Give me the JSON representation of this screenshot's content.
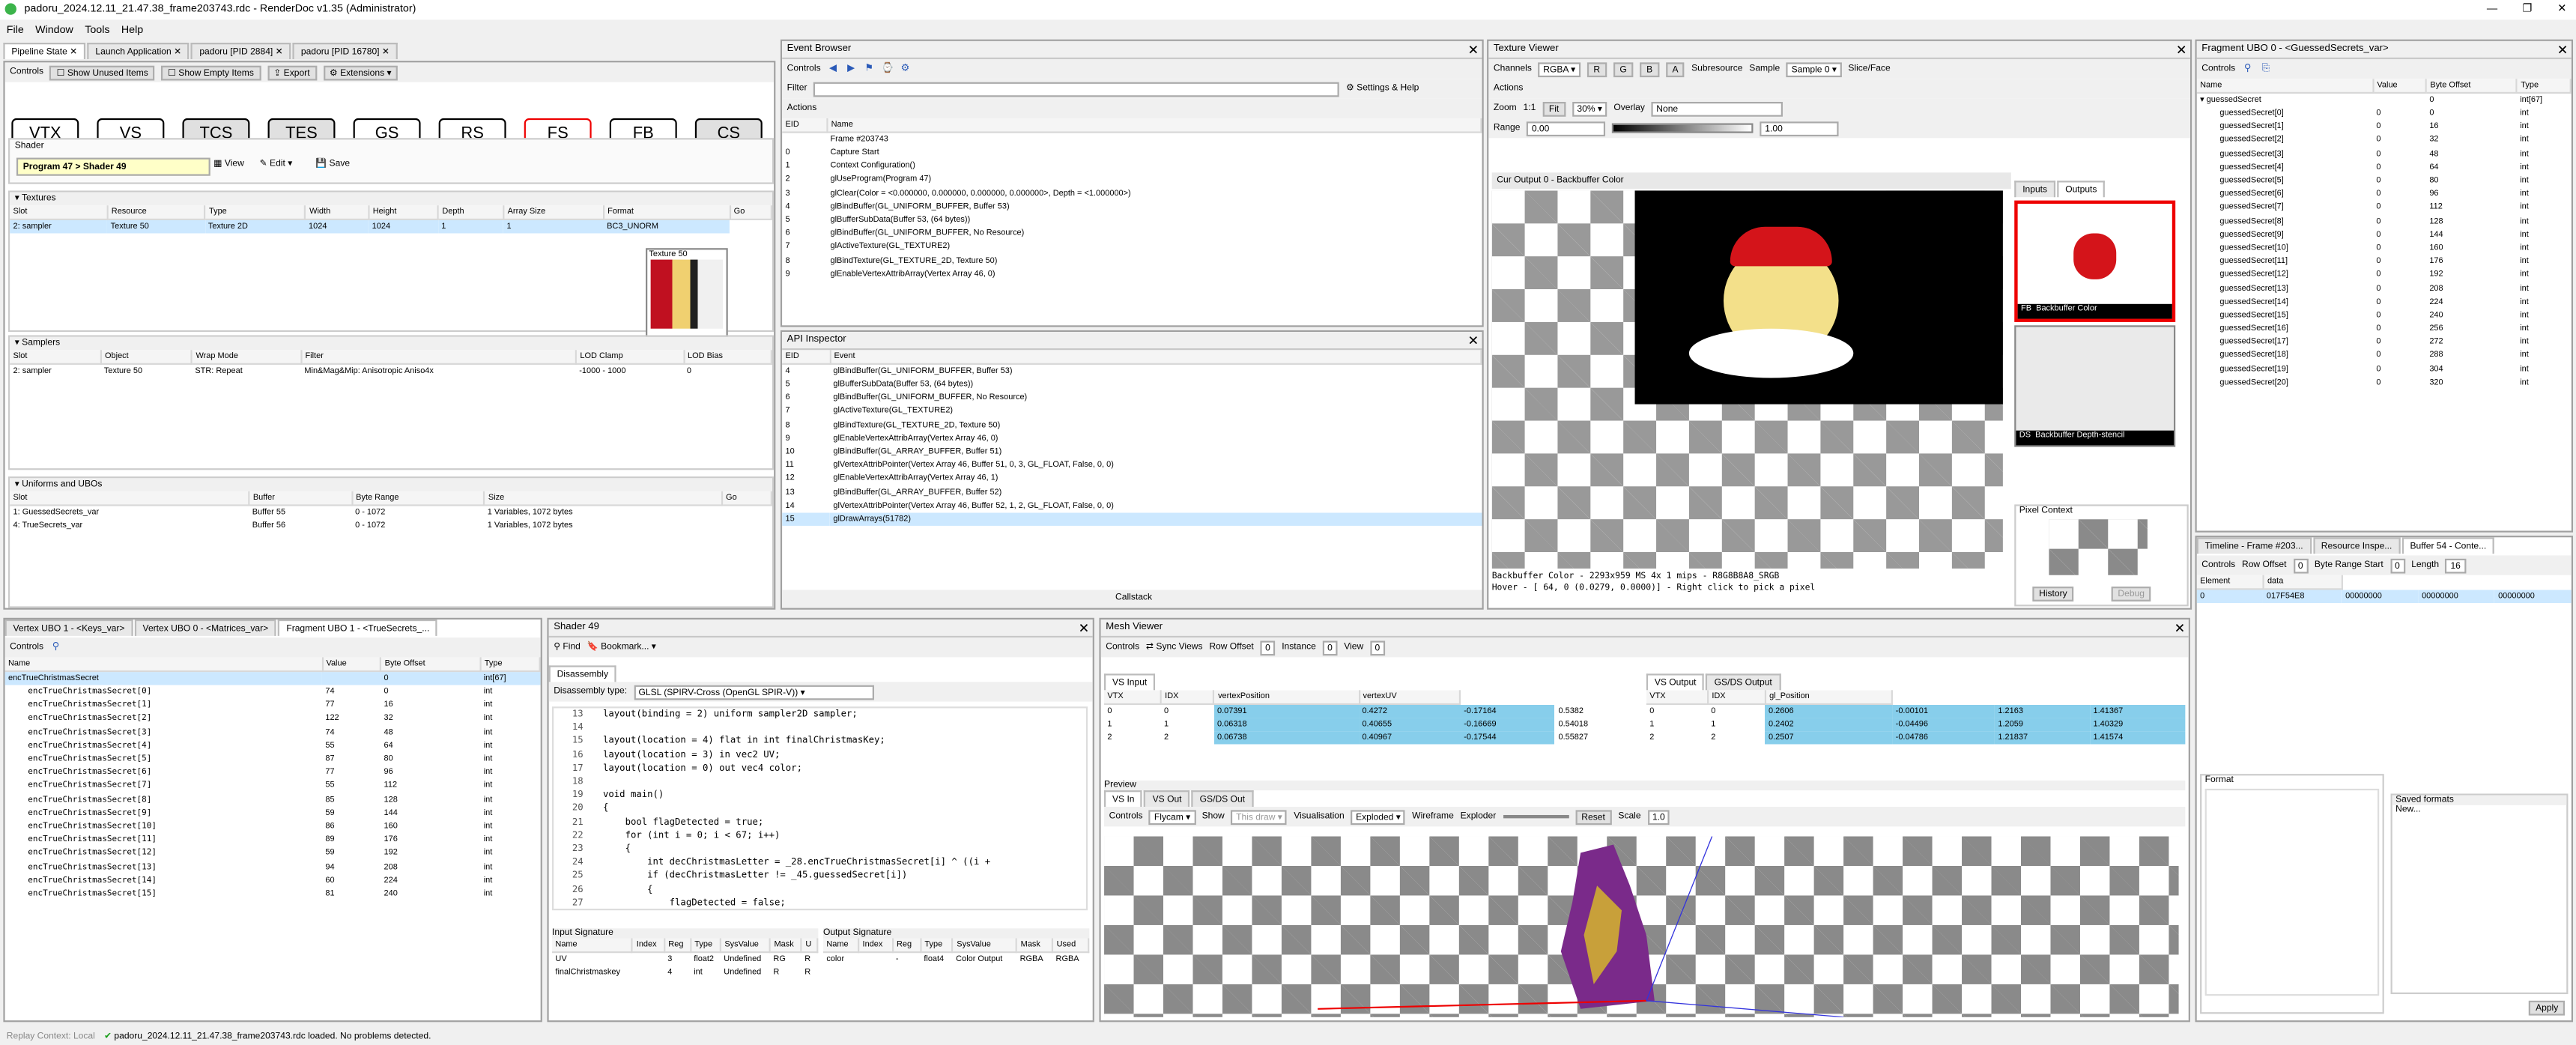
{
  "window": {
    "title": "padoru_2024.12.11_21.47.38_frame203743.rdc - RenderDoc v1.35 (Administrator)"
  },
  "menu": [
    "File",
    "Window",
    "Tools",
    "Help"
  ],
  "doc_tabs": [
    "Pipeline State",
    "Launch Application",
    "padoru [PID 2884]",
    "padoru [PID 16780]"
  ],
  "pipeline": {
    "toolbar": {
      "controls": "Controls",
      "unused": "Show Unused Items",
      "empty": "Show Empty Items",
      "export": "Export",
      "extensions": "Extensions"
    },
    "stages": [
      "VTX",
      "VS",
      "TCS",
      "TES",
      "GS",
      "RS",
      "FS",
      "FB",
      "CS"
    ],
    "shader_label": "Shader",
    "program": "Program 47",
    "shader": "Shader 49",
    "view": "View",
    "edit": "Edit",
    "save": "Save",
    "textures_label": "Textures",
    "tex_headers": [
      "Slot",
      "Resource",
      "Type",
      "Width",
      "Height",
      "Depth",
      "Array Size",
      "Format",
      "Go"
    ],
    "tex_row": [
      "2: sampler",
      "Texture 50",
      "Texture 2D",
      "1024",
      "1024",
      "1",
      "1",
      "BC3_UNORM"
    ],
    "tex_tooltip": "Texture 50",
    "samplers_label": "Samplers",
    "samp_headers": [
      "Slot",
      "Object",
      "Wrap Mode",
      "Filter",
      "LOD Clamp",
      "LOD Bias"
    ],
    "samp_row": [
      "2: sampler",
      "Texture 50",
      "STR: Repeat",
      "Min&Mag&Mip: Anisotropic Aniso4x",
      "-1000 - 1000",
      "0"
    ],
    "ubo_label": "Uniforms and UBOs",
    "ubo_headers": [
      "Slot",
      "Buffer",
      "Byte Range",
      "Size",
      "Go"
    ],
    "ubo_rows": [
      [
        "1: GuessedSecrets_var",
        "Buffer 55",
        "0 - 1072",
        "1 Variables, 1072 bytes"
      ],
      [
        "4: TrueSecrets_var",
        "Buffer 56",
        "0 - 1072",
        "1 Variables, 1072 bytes"
      ]
    ]
  },
  "event_browser": {
    "title": "Event Browser",
    "controls": "Controls",
    "filter": "Filter",
    "settings": "Settings & Help",
    "actions": "Actions",
    "headers": [
      "EID",
      "Name"
    ],
    "rows": [
      [
        "",
        "Frame #203743"
      ],
      [
        "0",
        "Capture Start"
      ],
      [
        "1",
        "Context Configuration()"
      ],
      [
        "2",
        "glUseProgram(Program 47)"
      ],
      [
        "3",
        "glClear(Color = <0.000000, 0.000000, 0.000000, 0.000000>, Depth = <1.000000>)"
      ],
      [
        "4",
        "glBindBuffer(GL_UNIFORM_BUFFER, Buffer 53)"
      ],
      [
        "5",
        "glBufferSubData(Buffer 53, (64 bytes))"
      ],
      [
        "6",
        "glBindBuffer(GL_UNIFORM_BUFFER, No Resource)"
      ],
      [
        "7",
        "glActiveTexture(GL_TEXTURE2)"
      ],
      [
        "8",
        "glBindTexture(GL_TEXTURE_2D, Texture 50)"
      ],
      [
        "9",
        "glEnableVertexAttribArray(Vertex Array 46, 0)"
      ]
    ]
  },
  "api_inspector": {
    "title": "API Inspector",
    "headers": [
      "EID",
      "Event"
    ],
    "rows": [
      [
        "4",
        "glBindBuffer(GL_UNIFORM_BUFFER, Buffer 53)"
      ],
      [
        "5",
        "glBufferSubData(Buffer 53, (64 bytes))"
      ],
      [
        "6",
        "glBindBuffer(GL_UNIFORM_BUFFER, No Resource)"
      ],
      [
        "7",
        "glActiveTexture(GL_TEXTURE2)"
      ],
      [
        "8",
        "glBindTexture(GL_TEXTURE_2D, Texture 50)"
      ],
      [
        "9",
        "glEnableVertexAttribArray(Vertex Array 46, 0)"
      ],
      [
        "10",
        "glBindBuffer(GL_ARRAY_BUFFER, Buffer 51)"
      ],
      [
        "11",
        "glVertexAttribPointer(Vertex Array 46, Buffer 51, 0, 3, GL_FLOAT, False, 0, 0)"
      ],
      [
        "12",
        "glEnableVertexAttribArray(Vertex Array 46, 1)"
      ],
      [
        "13",
        "glBindBuffer(GL_ARRAY_BUFFER, Buffer 52)"
      ],
      [
        "14",
        "glVertexAttribPointer(Vertex Array 46, Buffer 52, 1, 2, GL_FLOAT, False, 0, 0)"
      ],
      [
        "15",
        "glDrawArrays(51782)"
      ]
    ],
    "callstack": "Callstack"
  },
  "texture_viewer": {
    "title": "Texture Viewer",
    "channels": "Channels",
    "channels_val": "RGBA",
    "subresource": "Subresource",
    "sample": "Sample",
    "sample_val": "Sample 0",
    "slice": "Slice/Face",
    "actions": "Actions",
    "zoom": "Zoom",
    "zoom11": "1:1",
    "fit": "Fit",
    "zoom_val": "30%",
    "overlay": "Overlay",
    "overlay_val": "None",
    "range": "Range",
    "range_min": "0.00",
    "range_max": "1.00",
    "output_tab": "Cur Output 0 - Backbuffer Color",
    "inputs": "Inputs",
    "outputs": "Outputs",
    "thumb1": "FB",
    "thumb1_label": "Backbuffer Color",
    "thumb2": "DS",
    "thumb2_label": "Backbuffer Depth-stencil",
    "pixel_context": "Pixel Context",
    "history": "History",
    "debug": "Debug",
    "status1": "Backbuffer Color - 2293x959 MS 4x 1 mips - R8G8B8A8_SRGB",
    "status2": "Hover - [   64,     0 (0.0279, 0.0000)] - Right click to pick a pixel"
  },
  "frag_ubo": {
    "title": "Fragment UBO 0 - <GuessedSecrets_var>",
    "controls": "Controls",
    "headers": [
      "Name",
      "Value",
      "Byte Offset",
      "Type"
    ],
    "root": [
      "guessedSecret",
      "",
      "0",
      "int[67]"
    ],
    "rows": [
      [
        "guessedSecret[0]",
        "0",
        "0",
        "int"
      ],
      [
        "guessedSecret[1]",
        "0",
        "16",
        "int"
      ],
      [
        "guessedSecret[2]",
        "0",
        "32",
        "int"
      ],
      [
        "guessedSecret[3]",
        "0",
        "48",
        "int"
      ],
      [
        "guessedSecret[4]",
        "0",
        "64",
        "int"
      ],
      [
        "guessedSecret[5]",
        "0",
        "80",
        "int"
      ],
      [
        "guessedSecret[6]",
        "0",
        "96",
        "int"
      ],
      [
        "guessedSecret[7]",
        "0",
        "112",
        "int"
      ],
      [
        "guessedSecret[8]",
        "0",
        "128",
        "int"
      ],
      [
        "guessedSecret[9]",
        "0",
        "144",
        "int"
      ],
      [
        "guessedSecret[10]",
        "0",
        "160",
        "int"
      ],
      [
        "guessedSecret[11]",
        "0",
        "176",
        "int"
      ],
      [
        "guessedSecret[12]",
        "0",
        "192",
        "int"
      ],
      [
        "guessedSecret[13]",
        "0",
        "208",
        "int"
      ],
      [
        "guessedSecret[14]",
        "0",
        "224",
        "int"
      ],
      [
        "guessedSecret[15]",
        "0",
        "240",
        "int"
      ],
      [
        "guessedSecret[16]",
        "0",
        "256",
        "int"
      ],
      [
        "guessedSecret[17]",
        "0",
        "272",
        "int"
      ],
      [
        "guessedSecret[18]",
        "0",
        "288",
        "int"
      ],
      [
        "guessedSecret[19]",
        "0",
        "304",
        "int"
      ],
      [
        "guessedSecret[20]",
        "0",
        "320",
        "int"
      ]
    ]
  },
  "buffer54": {
    "tabs": [
      "Timeline - Frame #203...",
      "Resource Inspe...",
      "Buffer 54 - Conte..."
    ],
    "controls": "Controls",
    "row_offset": "Row Offset",
    "row_offset_val": "0",
    "byte_range": "Byte Range Start",
    "byte_range_val": "0",
    "length": "Length",
    "length_val": "16",
    "headers": [
      "Element",
      "data"
    ],
    "row": [
      "0",
      "017F54E8",
      "00000000",
      "00000000",
      "00000000"
    ],
    "format": "Format",
    "saved": "Saved formats",
    "new": "New...",
    "apply": "Apply"
  },
  "vertex_ubo": {
    "tabs": [
      "Vertex UBO 1 - <Keys_var>",
      "Vertex UBO 0 - <Matrices_var>",
      "Fragment UBO 1 - <TrueSecrets_..."
    ],
    "controls": "Controls",
    "headers": [
      "Name",
      "Value",
      "Byte Offset",
      "Type"
    ],
    "root": [
      "encTrueChristmasSecret",
      "",
      "0",
      "int[67]"
    ],
    "rows": [
      [
        "encTrueChristmasSecret[0]",
        "74",
        "0",
        "int"
      ],
      [
        "encTrueChristmasSecret[1]",
        "77",
        "16",
        "int"
      ],
      [
        "encTrueChristmasSecret[2]",
        "122",
        "32",
        "int"
      ],
      [
        "encTrueChristmasSecret[3]",
        "74",
        "48",
        "int"
      ],
      [
        "encTrueChristmasSecret[4]",
        "55",
        "64",
        "int"
      ],
      [
        "encTrueChristmasSecret[5]",
        "87",
        "80",
        "int"
      ],
      [
        "encTrueChristmasSecret[6]",
        "77",
        "96",
        "int"
      ],
      [
        "encTrueChristmasSecret[7]",
        "55",
        "112",
        "int"
      ],
      [
        "encTrueChristmasSecret[8]",
        "85",
        "128",
        "int"
      ],
      [
        "encTrueChristmasSecret[9]",
        "59",
        "144",
        "int"
      ],
      [
        "encTrueChristmasSecret[10]",
        "86",
        "160",
        "int"
      ],
      [
        "encTrueChristmasSecret[11]",
        "89",
        "176",
        "int"
      ],
      [
        "encTrueChristmasSecret[12]",
        "59",
        "192",
        "int"
      ],
      [
        "encTrueChristmasSecret[13]",
        "94",
        "208",
        "int"
      ],
      [
        "encTrueChristmasSecret[14]",
        "60",
        "224",
        "int"
      ],
      [
        "encTrueChristmasSecret[15]",
        "81",
        "240",
        "int"
      ]
    ]
  },
  "shader49": {
    "title": "Shader 49",
    "find": "Find",
    "bookmark": "Bookmark...",
    "disassembly_tab": "Disassembly",
    "dtype_label": "Disassembly type:",
    "dtype_val": "GLSL (SPIRV-Cross (OpenGL SPIR-V))",
    "lines": [
      [
        "13",
        "layout(binding = 2) uniform sampler2D sampler;"
      ],
      [
        "14",
        ""
      ],
      [
        "15",
        "layout(location = 4) flat in int finalChristmasKey;"
      ],
      [
        "16",
        "layout(location = 3) in vec2 UV;"
      ],
      [
        "17",
        "layout(location = 0) out vec4 color;"
      ],
      [
        "18",
        ""
      ],
      [
        "19",
        "void main()"
      ],
      [
        "20",
        "{"
      ],
      [
        "21",
        "    bool flagDetected = true;"
      ],
      [
        "22",
        "    for (int i = 0; i < 67; i++)"
      ],
      [
        "23",
        "    {"
      ],
      [
        "24",
        "        int decChristmasLetter = _28.encTrueChristmasSecret[i] ^ ((i +"
      ],
      [
        "25",
        "        if (decChristmasLetter != _45.guessedSecret[i])"
      ],
      [
        "26",
        "        {"
      ],
      [
        "27",
        "            flagDetected = false;"
      ]
    ],
    "input_sig": "Input Signature",
    "output_sig": "Output Signature",
    "in_headers": [
      "Name",
      "Index",
      "Reg",
      "Type",
      "SysValue",
      "Mask",
      "U"
    ],
    "in_rows": [
      [
        "UV",
        "",
        "3",
        "float2",
        "Undefined",
        "RG",
        "R"
      ],
      [
        "finalChristmaskey",
        "",
        "4",
        "int",
        "Undefined",
        "R",
        "R"
      ]
    ],
    "out_headers": [
      "Name",
      "Index",
      "Reg",
      "Type",
      "SysValue",
      "Mask",
      "Used"
    ],
    "out_rows": [
      [
        "color",
        "",
        "-",
        "float4",
        "Color Output",
        "RGBA",
        "RGBA"
      ]
    ]
  },
  "mesh_viewer": {
    "title": "Mesh Viewer",
    "controls": "Controls",
    "sync": "Sync Views",
    "row_offset": "Row Offset",
    "row_val": "0",
    "instance": "Instance",
    "inst_val": "0",
    "view": "View",
    "view_val": "0",
    "vs_input": "VS Input",
    "vs_output": "VS Output",
    "gs_output": "GS/DS Output",
    "in_headers": [
      "VTX",
      "IDX",
      "vertexPosition",
      "vertexUV"
    ],
    "in_rows": [
      [
        "0",
        "0",
        "0.07391",
        "0.4272",
        "-0.17164",
        "0.5382"
      ],
      [
        "1",
        "1",
        "0.06318",
        "0.40655",
        "-0.16669",
        "0.54018"
      ],
      [
        "2",
        "2",
        "0.06738",
        "0.40967",
        "-0.17544",
        "0.55827"
      ]
    ],
    "out_headers": [
      "VTX",
      "IDX",
      "gl_Position"
    ],
    "out_rows": [
      [
        "0",
        "0",
        "0.2606",
        "-0.00101",
        "1.2163",
        "1.41367"
      ],
      [
        "1",
        "1",
        "0.2402",
        "-0.04496",
        "1.2059",
        "1.40329"
      ],
      [
        "2",
        "2",
        "0.2507",
        "-0.04786",
        "1.21837",
        "1.41574"
      ]
    ],
    "preview": "Preview",
    "ptabs": [
      "VS In",
      "VS Out",
      "GS/DS Out"
    ],
    "pcontrols": "Controls",
    "cam": "Flycam",
    "show": "Show",
    "show_val": "This draw",
    "vis": "Visualisation",
    "vis_val": "Exploded",
    "wire": "Wireframe",
    "exploder": "Exploder",
    "reset": "Reset",
    "scale": "Scale",
    "scale_val": "1.0"
  },
  "status": {
    "replay": "Replay Context: Local",
    "msg": "padoru_2024.12.11_21.47.38_frame203743.rdc loaded. No problems detected."
  }
}
